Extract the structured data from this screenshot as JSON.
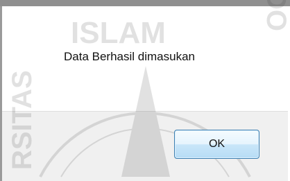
{
  "dialog": {
    "message": "Data Berhasil dimasukan",
    "ok_button_label": "OK"
  },
  "watermark": {
    "text_top": "ISLAM",
    "text_left": "RSITAS",
    "text_right": "INDO"
  },
  "colors": {
    "dialog_content_background": "#ffffff",
    "dialog_footer_background": "#f0f0f0",
    "button_border": "#3c7fb1",
    "button_fill": "#c9e6f9"
  }
}
